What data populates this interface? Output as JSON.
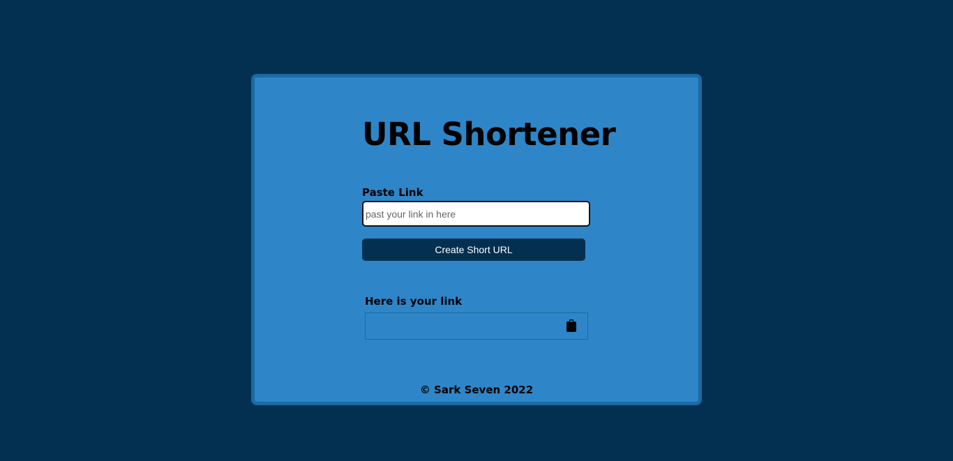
{
  "app": {
    "title": "URL Shortener"
  },
  "form": {
    "paste_label": "Paste Link",
    "input_value": "",
    "input_placeholder": "past your link in here",
    "create_button_label": "Create Short URL"
  },
  "result": {
    "label": "Here is your link",
    "short_url": "",
    "copy_icon": "clipboard-icon"
  },
  "footer": {
    "text": "© Sark Seven 2022"
  },
  "colors": {
    "background": "#033050",
    "card": "#2e86c8",
    "card_border": "#1a6aa6",
    "button": "#033050"
  }
}
